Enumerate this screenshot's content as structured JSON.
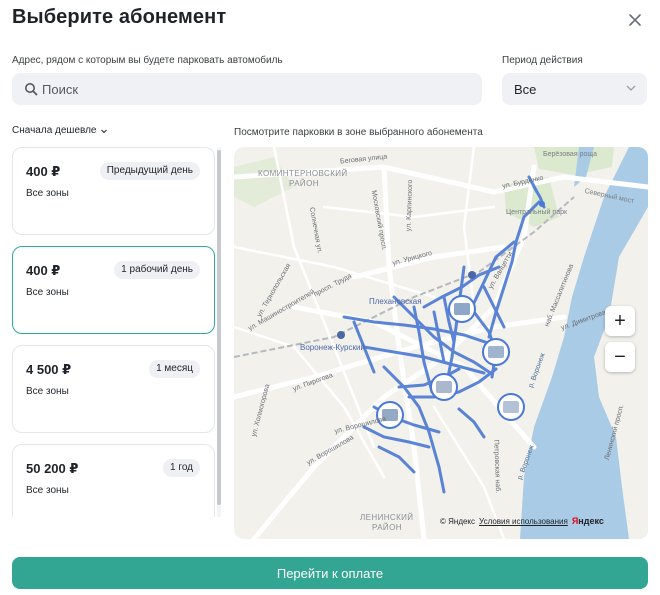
{
  "modal": {
    "title": "Выберите абонемент",
    "close_icon": "close-icon"
  },
  "address": {
    "label": "Адрес, рядом с которым вы будете парковать автомобиль",
    "placeholder": "Поиск",
    "value": ""
  },
  "period": {
    "label": "Период действия",
    "selected": "Все"
  },
  "sort": {
    "label": "Сначала дешевле"
  },
  "subscriptions": [
    {
      "price": "400 ₽",
      "badge": "Предыдущий день",
      "zones": "Все зоны",
      "selected": false
    },
    {
      "price": "400 ₽",
      "badge": "1 рабочий день",
      "zones": "Все зоны",
      "selected": true
    },
    {
      "price": "4 500 ₽",
      "badge": "1 месяц",
      "zones": "Все зоны",
      "selected": false
    },
    {
      "price": "50 200 ₽",
      "badge": "1 год",
      "zones": "Все зоны",
      "selected": false
    }
  ],
  "map": {
    "caption": "Посмотрите парковки в зоне выбранного абонемента",
    "districts": {
      "kominternovsky_1": "КОМИНТЕРНОВСКИЙ",
      "kominternovsky_2": "РАЙОН",
      "leninsky_1": "ЛЕНИНСКИЙ",
      "leninsky_2": "РАЙОН"
    },
    "places": {
      "berezovaya": "Берёзовая роща",
      "central_park": "Центральный парк",
      "plekhanovskaya": "Плехановская",
      "voronezh_kursky": "Воронеж-Курский",
      "severny_most": "Северный мост"
    },
    "streets": {
      "begovaya": "Беговая улица",
      "burdenko": "ул. Бурденко",
      "karpinskogo": "ул. Карпинского",
      "moskovsky": "Московский просп.",
      "truda": "просп. Труда",
      "urickogo": "ул. Урицкого",
      "vanceti": "ул. Ванцетти",
      "mashinostroiteley": "ул. Машиностроителей",
      "pirogova": "ул. Пирогова",
      "voroshilova_1": "ул. Ворошилова",
      "voroshilova_2": "ул. Ворошилова",
      "petrovskaya": "Петровская наб.",
      "massalitinova": "наб. Массалитинова",
      "dimitrova": "ул. Димитрова",
      "leninsky_prosp": "Ленинский просп.",
      "r_voronezh_1": "р. Воронеж",
      "r_voronezh_2": "р. Воронеж",
      "solnechnaya": "Солнечная ул.",
      "ternopolskaya": "ул. Тернопольская",
      "kholmogorova": "ул. Холмогорова"
    },
    "zoom_in": "+",
    "zoom_out": "−",
    "copyright": "© Яндекс",
    "terms": "Условия использования",
    "brand_first": "Я",
    "brand_rest": "ндекс"
  },
  "actions": {
    "pay": "Перейти к оплате"
  },
  "colors": {
    "accent": "#33a593",
    "selected_border": "#32a99a",
    "parking_line": "#4a78d4",
    "water": "#a9cbe6"
  }
}
